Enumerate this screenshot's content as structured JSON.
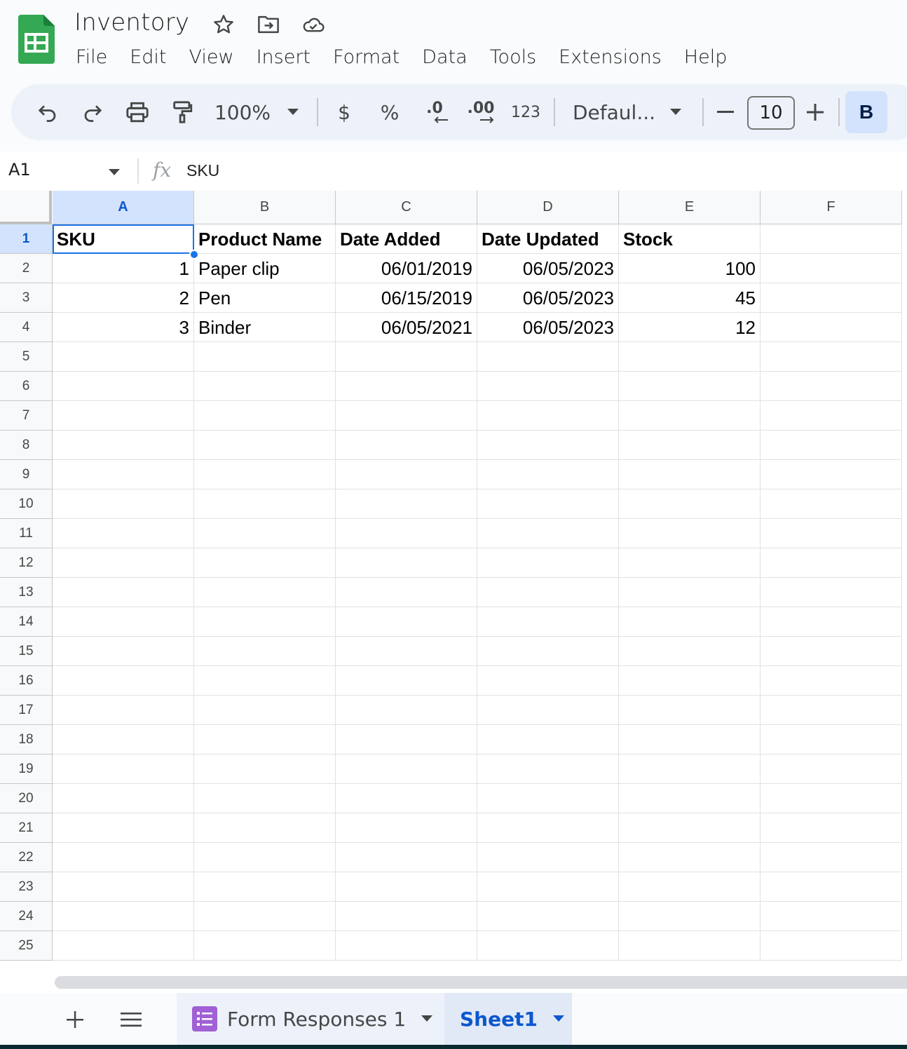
{
  "header": {
    "title": "Inventory",
    "menu": [
      "File",
      "Edit",
      "View",
      "Insert",
      "Format",
      "Data",
      "Tools",
      "Extensions",
      "Help"
    ]
  },
  "toolbar": {
    "zoom": "100%",
    "currency": "$",
    "percent": "%",
    "decrease_decimal": ".0",
    "increase_decimal": ".00",
    "number_format": "123",
    "font": "Defaul...",
    "font_size": "10",
    "bold": "B"
  },
  "formula_bar": {
    "cell_ref": "A1",
    "fx": "fx",
    "value": "SKU"
  },
  "columns": [
    "A",
    "B",
    "C",
    "D",
    "E",
    "F"
  ],
  "rows": [
    "1",
    "2",
    "3",
    "4",
    "5",
    "6",
    "7",
    "8",
    "9",
    "10",
    "11",
    "12",
    "13",
    "14",
    "15",
    "16",
    "17",
    "18",
    "19",
    "20",
    "21",
    "22",
    "23",
    "24",
    "25"
  ],
  "cells": {
    "header": [
      "SKU",
      "Product Name",
      "Date Added",
      "Date Updated",
      "Stock"
    ],
    "data": [
      [
        "1",
        "Paper clip",
        "06/01/2019",
        "06/05/2023",
        "100"
      ],
      [
        "2",
        "Pen",
        "06/15/2019",
        "06/05/2023",
        "45"
      ],
      [
        "3",
        "Binder",
        "06/05/2021",
        "06/05/2023",
        "12"
      ]
    ]
  },
  "sheets": {
    "tabs": [
      "Form Responses 1",
      "Sheet1"
    ],
    "active": "Sheet1"
  },
  "colors": {
    "accent": "#0b57d0",
    "selection": "#1a73e8",
    "toolbar_bg": "#edf2fa"
  }
}
